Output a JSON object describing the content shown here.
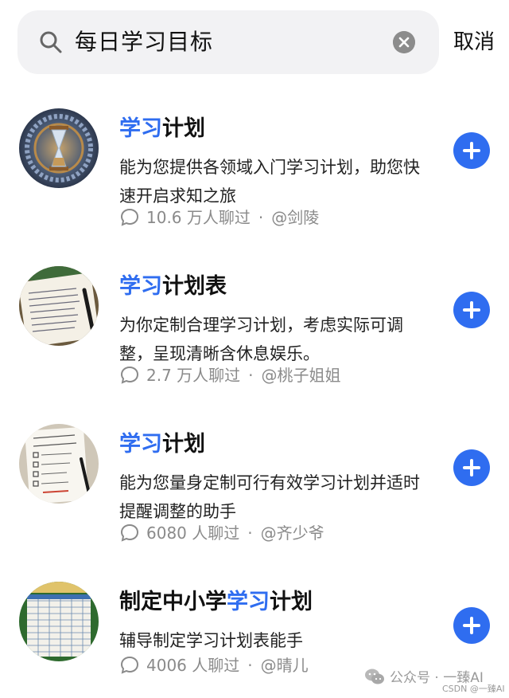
{
  "search": {
    "query": "每日学习目标",
    "cancel_label": "取消"
  },
  "results": [
    {
      "title_highlight": "学习",
      "title_rest": "计划",
      "description": "能为您提供各领域入门学习计划，助您快速开启求知之旅",
      "chats": "10.6 万人聊过",
      "author": "@剑陵"
    },
    {
      "title_highlight": "学习",
      "title_rest": "计划表",
      "description": "为你定制合理学习计划，考虑实际可调整，呈现清晰含休息娱乐。",
      "chats": "2.7 万人聊过",
      "author": "@桃子姐姐"
    },
    {
      "title_highlight": "学习",
      "title_rest": "计划",
      "description": "能为您量身定制可行有效学习计划并适时提醒调整的助手",
      "chats": "6080 人聊过",
      "author": "@齐少爷"
    },
    {
      "title_prefix": "制定中小学",
      "title_highlight": "学习",
      "title_rest": "计划",
      "description": "辅导制定学习计划表能手",
      "chats": "4006 人聊过",
      "author": "@晴儿"
    }
  ],
  "separator": "·",
  "watermark": {
    "text": "公众号 · 一臻AI",
    "csdn": "CSDN @一臻AI"
  },
  "colors": {
    "accent": "#2f6df0",
    "meta": "#8a8a8a",
    "search_bg": "#f2f2f4"
  },
  "icons": [
    "search-icon",
    "clear-icon",
    "chat-bubble-icon",
    "plus-icon",
    "wechat-icon"
  ]
}
